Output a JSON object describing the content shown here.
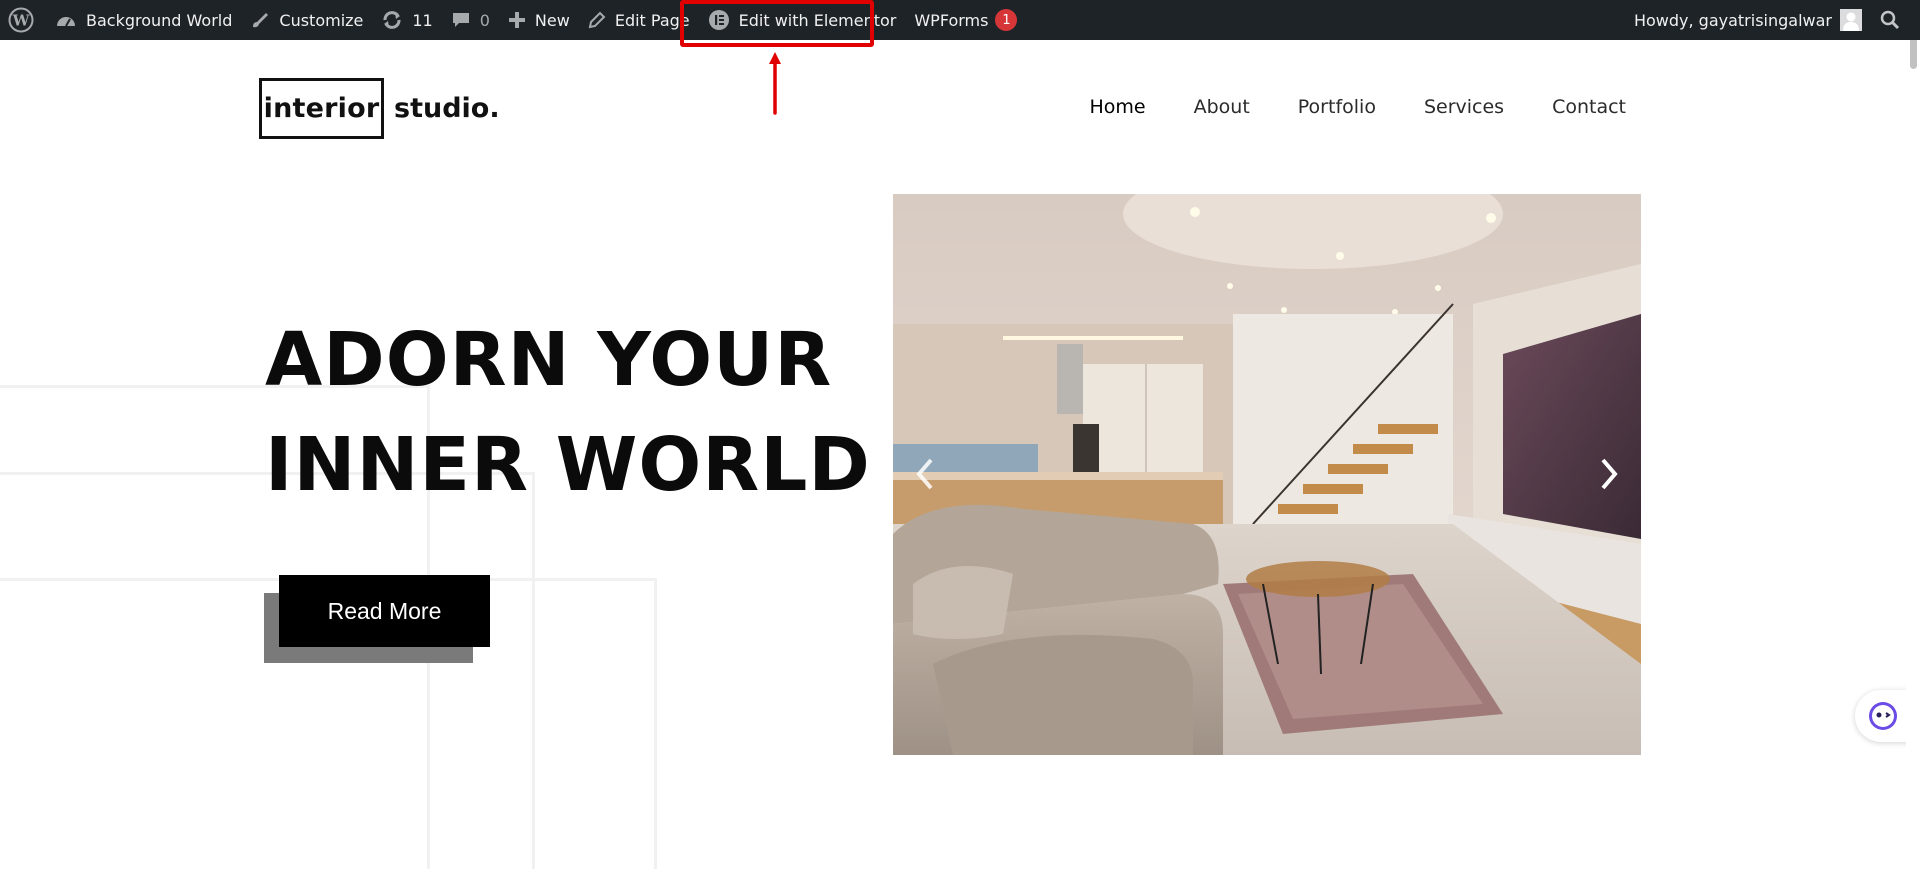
{
  "admin_bar": {
    "site_name": "Background World",
    "customize": "Customize",
    "updates_count": "11",
    "comments_count": "0",
    "new_label": "New",
    "edit_page": "Edit Page",
    "edit_with_elementor": "Edit with Elementor",
    "wpforms": "WPForms",
    "wpforms_badge": "1",
    "howdy": "Howdy, gayatrisingalwar"
  },
  "logo": {
    "boxed": "interior",
    "rest": "studio."
  },
  "nav": {
    "items": [
      "Home",
      "About",
      "Portfolio",
      "Services",
      "Contact"
    ],
    "active": "Home"
  },
  "hero": {
    "line1": "ADORN YOUR",
    "line2": "INNER WORLD",
    "button": "Read More"
  },
  "colors": {
    "admin_bar": "#1d2327",
    "highlight": "#e00000",
    "badge": "#d63638",
    "button": "#000000",
    "button_shadow": "#7a7a7a"
  },
  "icons": {
    "admin_bar": [
      "wordpress-logo-icon",
      "dashboard-icon",
      "brush-icon",
      "updates-icon",
      "comment-icon",
      "plus-icon",
      "pencil-icon",
      "elementor-icon",
      "search-icon"
    ],
    "slider": [
      "chevron-left-icon",
      "chevron-right-icon"
    ]
  }
}
